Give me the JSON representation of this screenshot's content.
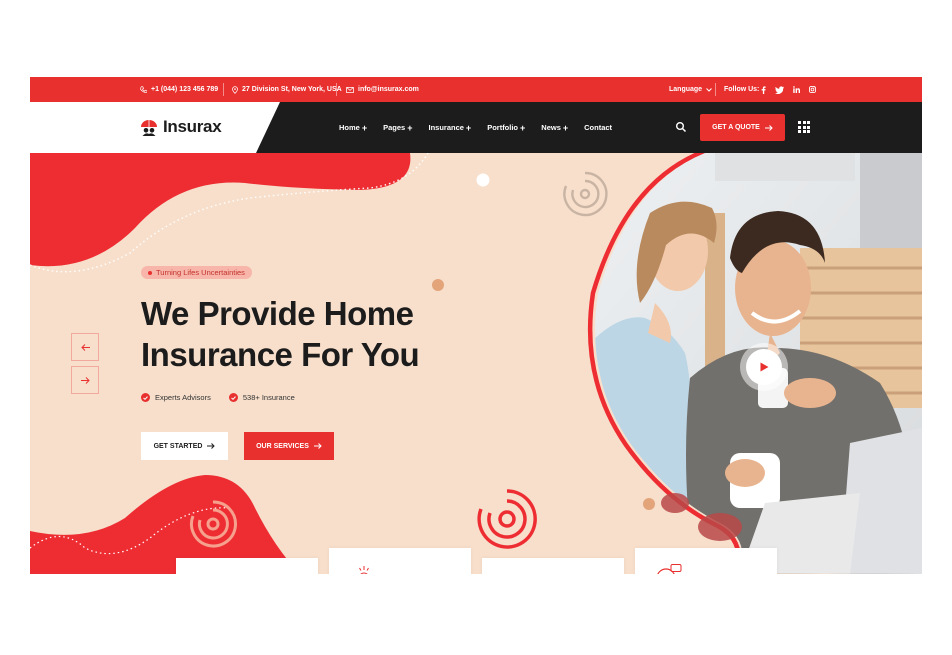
{
  "topbar": {
    "phone": "+1 (044) 123 456 789",
    "address": "27 Division St, New York, USA",
    "email": "info@insurax.com",
    "language": "Language",
    "follow_label": "Follow Us:",
    "social": [
      "facebook-icon",
      "twitter-icon",
      "linkedin-icon",
      "instagram-icon"
    ]
  },
  "nav": {
    "logo_text": "Insurax",
    "menu": [
      {
        "label": "Home",
        "has_submenu": true
      },
      {
        "label": "Pages",
        "has_submenu": true
      },
      {
        "label": "Insurance",
        "has_submenu": true
      },
      {
        "label": "Portfolio",
        "has_submenu": true
      },
      {
        "label": "News",
        "has_submenu": true
      },
      {
        "label": "Contact",
        "has_submenu": false
      }
    ],
    "plus": "+",
    "quote_label": "GET A QUOTE"
  },
  "hero": {
    "tagline": "Turning Lifes Uncertainties",
    "headline_line1": "We Provide Home",
    "headline_line2": "Insurance For You",
    "features": [
      "Experts Advisors",
      "538+ Insurance"
    ],
    "primary_button": "GET STARTED",
    "secondary_button": "OUR SERVICES"
  },
  "colors": {
    "brand_red": "#e8302f",
    "dark": "#1c1c1c",
    "peach": "#f7dfcb"
  }
}
